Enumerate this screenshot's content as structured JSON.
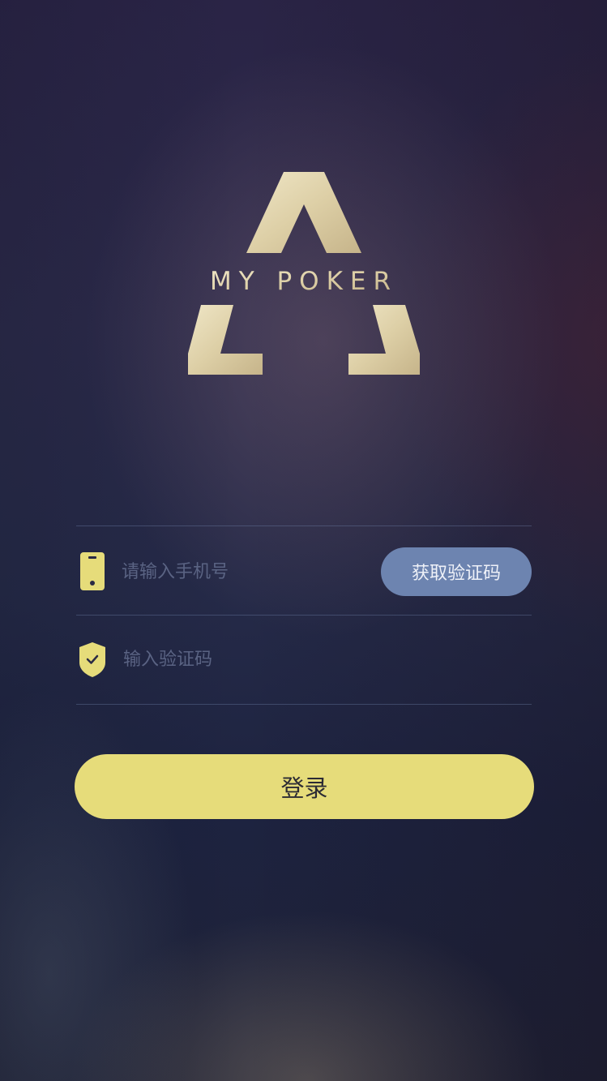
{
  "brand": {
    "logo_text": "MY POKER",
    "logo_color": "#d9ccaa"
  },
  "form": {
    "phone": {
      "placeholder": "请输入手机号",
      "value": "",
      "icon": "phone-icon"
    },
    "get_code_label": "获取验证码",
    "code": {
      "placeholder": "输入验证码",
      "value": "",
      "icon": "shield-check-icon"
    },
    "login_label": "登录"
  },
  "colors": {
    "accent_yellow": "#e6dc7a",
    "code_button": "#6d84b0",
    "icon_yellow": "#e6dc7a"
  }
}
